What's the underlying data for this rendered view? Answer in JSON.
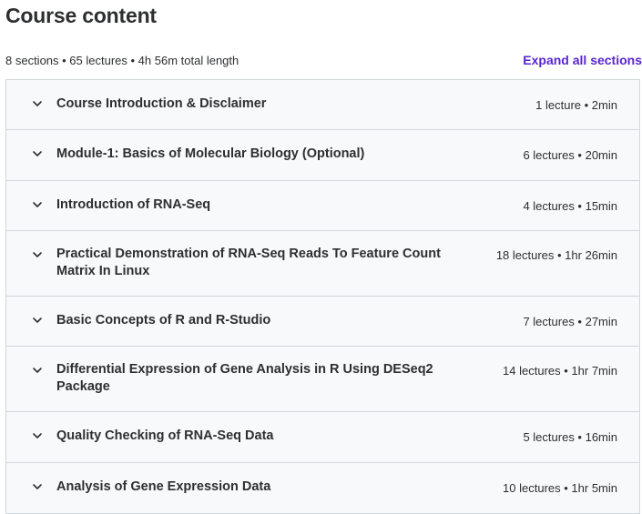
{
  "header": {
    "title": "Course content",
    "summary": "8 sections • 65 lectures • 4h 56m total length",
    "expand_label": "Expand all sections"
  },
  "colors": {
    "accent": "#5624d0",
    "row_bg": "#f7f9fa",
    "border": "#d1d7dc",
    "text": "#2d2f31"
  },
  "sections": [
    {
      "title": "Course Introduction & Disclaimer",
      "info": "1 lecture • 2min",
      "icon": "chevron-down-icon"
    },
    {
      "title": "Module-1: Basics of Molecular Biology (Optional)",
      "info": "6 lectures • 20min",
      "icon": "chevron-down-icon"
    },
    {
      "title": "Introduction of RNA-Seq",
      "info": "4 lectures • 15min",
      "icon": "chevron-down-icon"
    },
    {
      "title": "Practical Demonstration of RNA-Seq Reads To Feature Count Matrix In Linux",
      "info": "18 lectures • 1hr 26min",
      "icon": "chevron-down-icon"
    },
    {
      "title": "Basic Concepts of R and R-Studio",
      "info": "7 lectures • 27min",
      "icon": "chevron-down-icon"
    },
    {
      "title": "Differential Expression of Gene Analysis in R Using DESeq2 Package",
      "info": "14 lectures • 1hr 7min",
      "icon": "chevron-down-icon"
    },
    {
      "title": "Quality Checking of RNA-Seq Data",
      "info": "5 lectures • 16min",
      "icon": "chevron-down-icon"
    },
    {
      "title": "Analysis of Gene Expression Data",
      "info": "10 lectures • 1hr 5min",
      "icon": "chevron-down-icon"
    }
  ]
}
